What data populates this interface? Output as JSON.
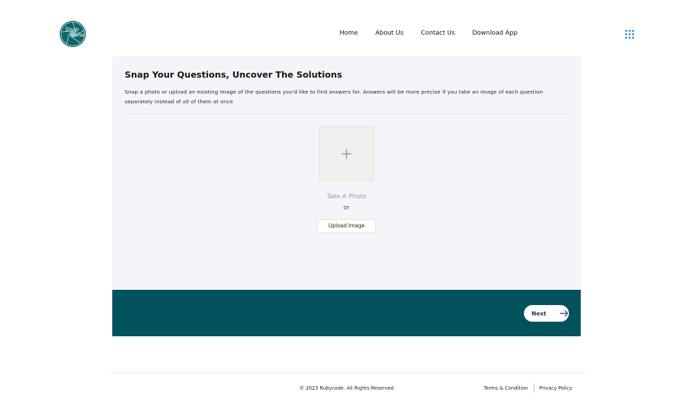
{
  "header": {
    "logo": {
      "text_line1": "Snap",
      "text_line2": "Solve",
      "icon": "aperture-logo-icon"
    },
    "nav": [
      {
        "label": "Home"
      },
      {
        "label": "About Us"
      },
      {
        "label": "Contact Us"
      },
      {
        "label": "Download App"
      }
    ],
    "menu_icon": "grid-dots-icon"
  },
  "main": {
    "title": "Snap Your Questions, Uncover The Solutions",
    "description": "Snap a photo or upload an existing image of the questions you'd like to find answers for. Answers will be more precise if you take an image of each question separately instead of all of them at once",
    "photo_placeholder_icon": "plus-icon",
    "take_photo_label": "Take A Photo",
    "or_label": "or",
    "upload_label": "Upload Image",
    "next_label": "Next",
    "next_icon": "arrow-right-icon"
  },
  "footer": {
    "copyright": "© 2023 Rubycode. All Rights Reserved.",
    "terms": "Terms & Condition",
    "privacy": "Privacy Policy"
  },
  "colors": {
    "accent_band": "#02525e",
    "card_bg": "#f6f4f9",
    "menu_icon": "#3b8fd8"
  }
}
